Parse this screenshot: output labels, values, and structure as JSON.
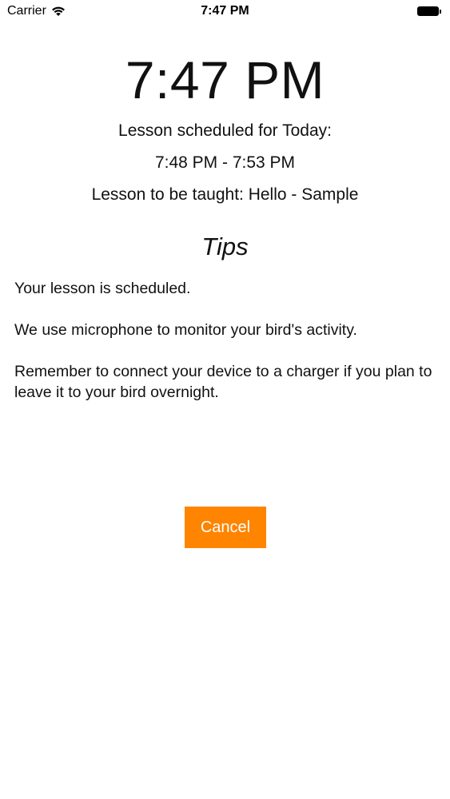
{
  "status_bar": {
    "carrier": "Carrier",
    "time": "7:47 PM",
    "wifi_icon": "wifi-icon",
    "battery_icon": "battery-icon"
  },
  "lesson": {
    "current_time": "7:47 PM",
    "scheduled_label": "Lesson scheduled for Today:",
    "time_range": "7:48 PM - 7:53 PM",
    "taught_label": "Lesson to be taught: Hello - Sample"
  },
  "tips": {
    "title": "Tips",
    "items": [
      "Your lesson is scheduled.",
      "We use microphone to monitor your bird's activity.",
      "Remember to connect your device to a charger if you plan to leave it to your bird overnight."
    ]
  },
  "actions": {
    "cancel_label": "Cancel"
  },
  "colors": {
    "accent": "#ff8400",
    "text": "#111111",
    "background": "#ffffff"
  }
}
